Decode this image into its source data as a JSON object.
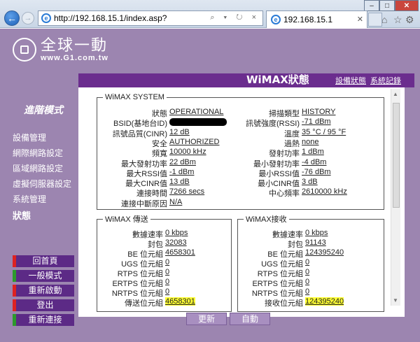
{
  "browser": {
    "url": "http://192.168.15.1/index.asp?",
    "tab_title": "192.168.15.1",
    "address_tools": "⌕ ▾ ↻ ×",
    "home_icon": "home-icon",
    "star_icon": "star-icon",
    "gear_icon": "gear-icon"
  },
  "logo": {
    "cn": "全球一動",
    "url": "www.G1.com.tw"
  },
  "header": {
    "title": "WiMAX狀態",
    "links": [
      "設備狀態",
      "系統記錄"
    ]
  },
  "sidebar": {
    "mode": "進階模式",
    "items": [
      "設備管理",
      "網際網路設定",
      "區域網路設定",
      "虛擬伺服器設定",
      "系統管理",
      "狀態"
    ],
    "buttons": [
      "回首頁",
      "一般模式",
      "重新啟動",
      "登出",
      "重新連接"
    ]
  },
  "system": {
    "legend": "WiMAX SYSTEM",
    "left": [
      {
        "label": "狀態",
        "value": "OPERATIONAL"
      },
      {
        "label": "BSID(基地台ID)",
        "value": ""
      },
      {
        "label": "訊號品質(CINR)",
        "value": "12 dB"
      },
      {
        "label": "安全",
        "value": "AUTHORIZED"
      },
      {
        "label": "頻寬",
        "value": "10000 kHz"
      },
      {
        "label": "最大發射功率",
        "value": "22 dBm"
      },
      {
        "label": "最大RSSI值",
        "value": "-1 dBm"
      },
      {
        "label": "最大CINR值",
        "value": "13 dB"
      },
      {
        "label": "連接時間",
        "value": "7266 secs"
      },
      {
        "label": "連接中斷原因",
        "value": "N/A"
      }
    ],
    "right": [
      {
        "label": "掃描類型",
        "value": "HISTORY"
      },
      {
        "label": "訊號強度(RSSI)",
        "value": "-71 dBm"
      },
      {
        "label": "溫度",
        "value": "35 °C / 95 °F"
      },
      {
        "label": "過熱",
        "value": "none"
      },
      {
        "label": "發射功率",
        "value": "1 dBm"
      },
      {
        "label": "最小發射功率",
        "value": "-4 dBm"
      },
      {
        "label": "最小RSSI值",
        "value": "-76 dBm"
      },
      {
        "label": "最小CINR值",
        "value": "3 dB"
      },
      {
        "label": "中心頻率",
        "value": "2610000 kHz"
      }
    ]
  },
  "tx": {
    "legend": "WiMAX 傳送",
    "rows": [
      {
        "label": "數據速率",
        "value": "0 kbps"
      },
      {
        "label": "封包",
        "value": "32083"
      },
      {
        "label": "BE 位元組",
        "value": "4658301"
      },
      {
        "label": "UGS 位元組",
        "value": "0"
      },
      {
        "label": "RTPS 位元組",
        "value": "0"
      },
      {
        "label": "ERTPS 位元組",
        "value": "0"
      },
      {
        "label": "NRTPS 位元組",
        "value": "0"
      },
      {
        "label": "傳送位元組",
        "value": "4658301"
      }
    ]
  },
  "rx": {
    "legend": "WiMAX接收",
    "rows": [
      {
        "label": "數據速率",
        "value": "0 kbps"
      },
      {
        "label": "封包",
        "value": "91143"
      },
      {
        "label": "BE 位元組",
        "value": "124395240"
      },
      {
        "label": "UGS 位元組",
        "value": "0"
      },
      {
        "label": "RTPS 位元組",
        "value": "0"
      },
      {
        "label": "ERTPS 位元組",
        "value": "0"
      },
      {
        "label": "NRTPS 位元組",
        "value": "0"
      },
      {
        "label": "接收位元組",
        "value": "124395240"
      }
    ]
  },
  "actions": {
    "refresh": "更新",
    "auto": "自動"
  }
}
